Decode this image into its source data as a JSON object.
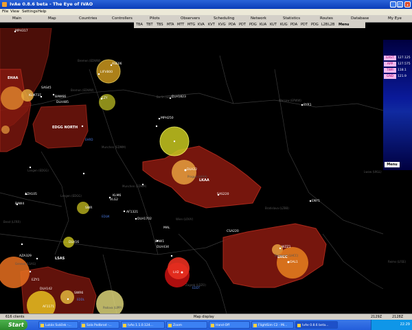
{
  "window": {
    "title": "IvAe 0.8.6 beta - The Eye of IVAO"
  },
  "menu": [
    "File",
    "View",
    "Settings",
    "Help"
  ],
  "tabs": [
    "Main",
    "Map",
    "Countries",
    "Controllers",
    "Pilots",
    "Observers",
    "Scheduling",
    "Network",
    "Statistics",
    "Routes",
    "Database",
    "My Eye"
  ],
  "subtabs": [
    "TBA",
    "TBT",
    "TBS",
    "MTA",
    "MTT",
    "MTG",
    "KVA",
    "KVT",
    "KVG",
    "PDA",
    "PDT",
    "PDG",
    "KUA",
    "KUT",
    "KUG",
    "PDA",
    "PDT",
    "PDG",
    "L2B",
    "L2B"
  ],
  "subtab_menu": "Menu",
  "sidepanel": {
    "controllers": [
      {
        "name": "EAST",
        "freq": "127.125"
      },
      {
        "name": "APP",
        "freq": "127.575"
      },
      {
        "name": "TWR",
        "freq": "118.1"
      },
      {
        "name": "GND",
        "freq": "121.9"
      }
    ],
    "menu_label": "Menu"
  },
  "map": {
    "fir_labels": [
      "EHAA",
      "EDGG NORTH",
      "LKAA",
      "LHCC",
      "LSAS"
    ],
    "aircraft": [
      "MPH317",
      "KLM737",
      "BAW66",
      "SAS45",
      "DLH485",
      "LIFV800",
      "ASE06",
      "EZY",
      "DLH1823",
      "MPH250",
      "DLH22",
      "AZA105",
      "BAW4",
      "AF1321",
      "VLG2",
      "SWR",
      "KLM6",
      "DLH16",
      "DLH1702",
      "DLH434",
      "BAW1",
      "SWR6",
      "AZA329",
      "DLH142",
      "EZY1",
      "LH2",
      "SAS220",
      "WZZ1",
      "MAL",
      "CSA220",
      "OAL1",
      "RYR1",
      "AF1171",
      "ENY1"
    ],
    "cities": [
      "Bremen (EDWW)",
      "Bremen (EDWW)",
      "Berlin (EDBB)",
      "Warsaw (EPWW)",
      "Langen (EDGG)",
      "Langen (EDGG)",
      "Munchen (EDMM)",
      "Munchen (EDMM)",
      "Prague (LKAA)",
      "Wien (LOVV)",
      "Bratislava (LZBB)",
      "Budapest (LHCC)",
      "Zagreb (LDZO)",
      "Geneva (LSAG)",
      "Padova (LIPP)",
      "Lwow (UKLL)",
      "Brest (LFRR)",
      "Reims (LFEE)"
    ],
    "blue_labels": [
      "EHRD",
      "EDLW",
      "EDDL",
      "EDDT"
    ]
  },
  "status": {
    "clients": "616 clients",
    "center": "Map display",
    "time1": "2129Z",
    "time2": "2128Z"
  },
  "taskbar": {
    "start": "Start",
    "items": [
      "Lukás Sváček -...",
      "Sala Podbrod -...",
      "IvAo 1.1.0.124...",
      "Zoom",
      "Hand-Off",
      "FlightSim C2 - Mi...",
      "IvAe 0.8.6 beta..."
    ],
    "clock": "22:29"
  },
  "colors": {
    "fir_fill": "#8b1a10",
    "fir_stroke": "#c83020",
    "circle_yellow": "#d8d020",
    "circle_orange": "#e88020",
    "taskbar": "#245edb"
  }
}
